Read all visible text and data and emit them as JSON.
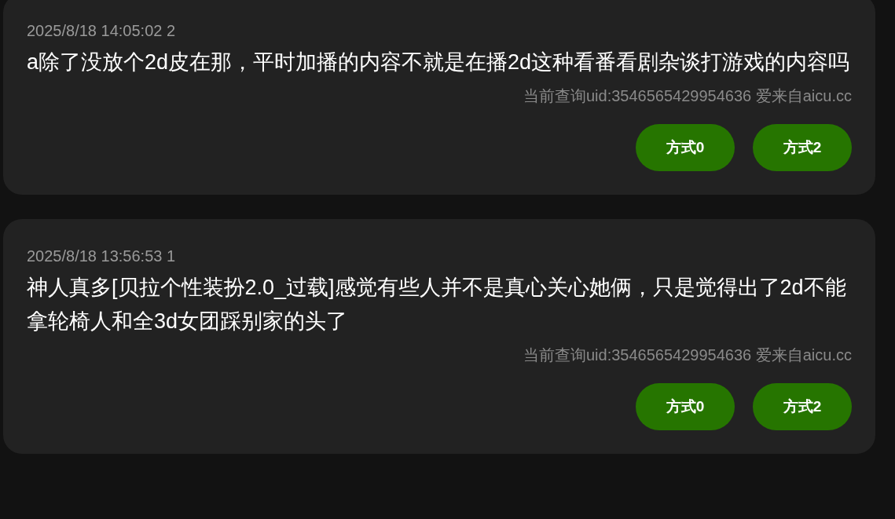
{
  "comments": [
    {
      "time": "2025/8/18 14:05:02 2",
      "text": "a除了没放个2d皮在那，平时加播的内容不就是在播2d这种看番看剧杂谈打游戏的内容吗",
      "meta": "当前查询uid:3546565429954636 爱来自aicu.cc",
      "buttons": [
        "方式0",
        "方式2"
      ]
    },
    {
      "time": "2025/8/18 13:56:53 1",
      "text": "神人真多[贝拉个性装扮2.0_过载]感觉有些人并不是真心关心她俩，只是觉得出了2d不能拿轮椅人和全3d女团踩别家的头了",
      "meta": "当前查询uid:3546565429954636 爱来自aicu.cc",
      "buttons": [
        "方式0",
        "方式2"
      ]
    }
  ]
}
